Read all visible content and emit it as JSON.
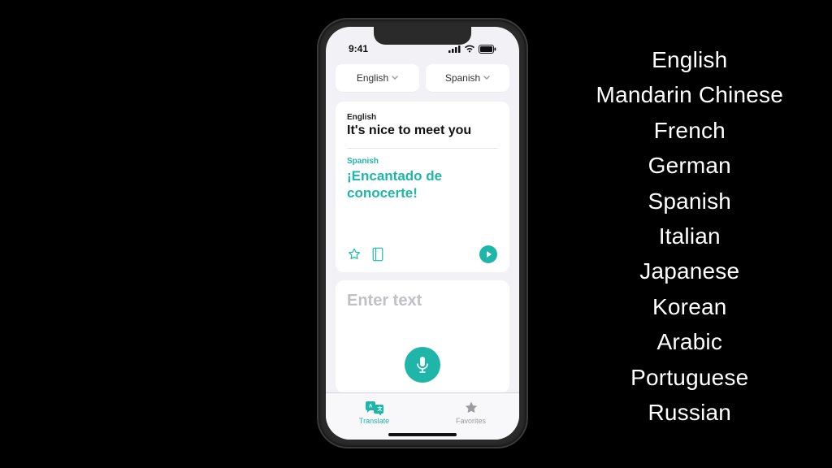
{
  "statusbar": {
    "time": "9:41"
  },
  "language_selectors": {
    "source": "English",
    "target": "Spanish"
  },
  "translation": {
    "source_lang_label": "English",
    "source_text": "It's nice to meet you",
    "target_lang_label": "Spanish",
    "target_text": "¡Encantado de conocerte!"
  },
  "input": {
    "placeholder": "Enter text"
  },
  "tabs": {
    "translate": "Translate",
    "favorites": "Favorites"
  },
  "supported_languages": [
    "English",
    "Mandarin Chinese",
    "French",
    "German",
    "Spanish",
    "Italian",
    "Japanese",
    "Korean",
    "Arabic",
    "Portuguese",
    "Russian"
  ],
  "colors": {
    "accent": "#1fb6a9"
  }
}
